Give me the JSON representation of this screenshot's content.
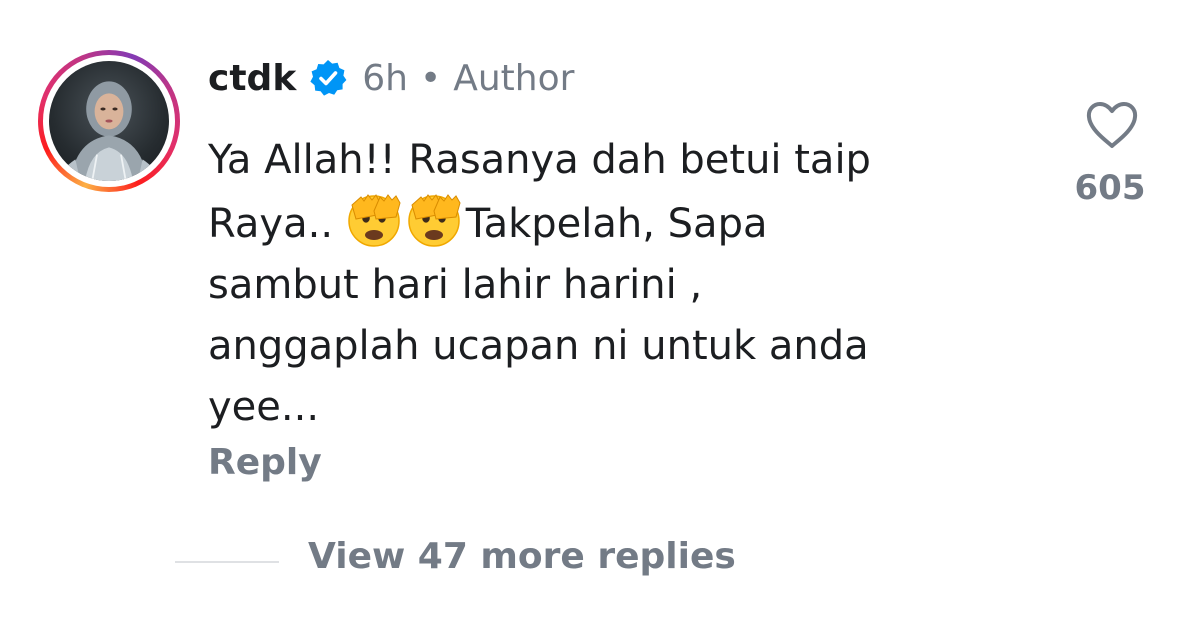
{
  "comment": {
    "username": "ctdk",
    "verified_icon": "verified-badge-icon",
    "timestamp": "6h",
    "separator": "•",
    "role": "Author",
    "text_line1": "Ya Allah!! Rasanya dah betui taip",
    "text_line2_prefix": "Raya..",
    "emoji_name": "face-with-open-eyes-and-hand-over-mouth",
    "text_line2_suffix": "Takpelah, Sapa",
    "text_line3": "sambut hari lahir harini ,",
    "text_line4": "anggaplah ucapan ni untuk anda",
    "text_line5": "yee...",
    "reply_label": "Reply",
    "like_icon": "heart-outline-icon",
    "like_count": "605"
  },
  "replies": {
    "view_more_label": "View 47 more replies"
  },
  "colors": {
    "text_primary": "#1c1e21",
    "text_secondary": "#737b86",
    "verified_blue": "#0095f6",
    "story_ring_start": "#fcb045",
    "story_ring_end": "#833ab4",
    "divider": "#dfe1e4"
  }
}
